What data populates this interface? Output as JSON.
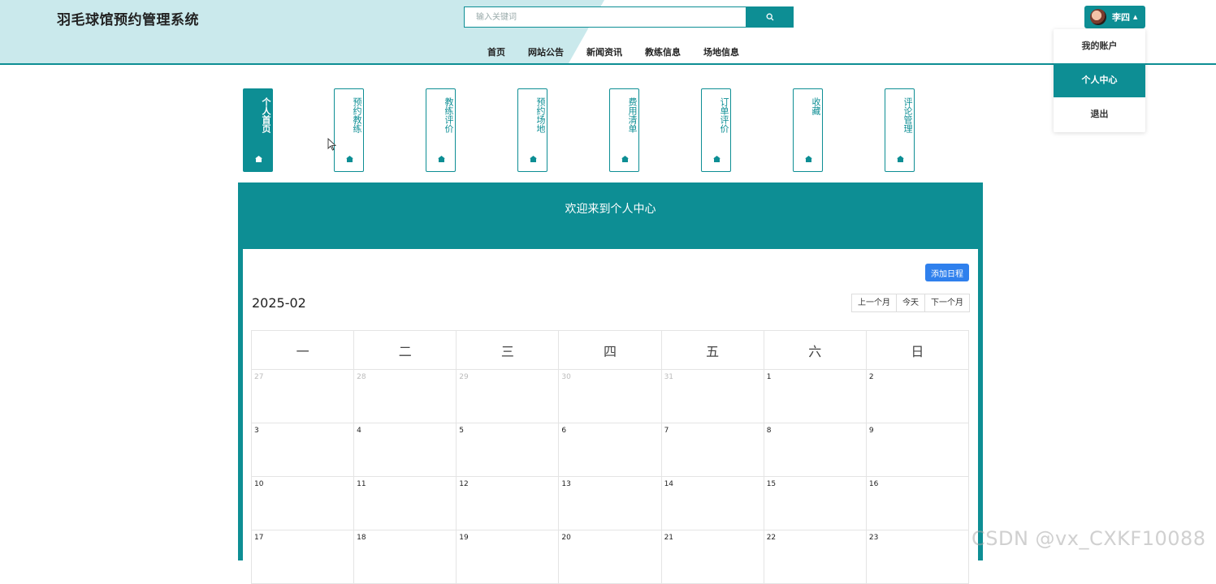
{
  "header": {
    "site_title": "羽毛球馆预约管理系统",
    "search_placeholder": "输入关键词",
    "nav": [
      "首页",
      "网站公告",
      "新闻资讯",
      "教练信息",
      "场地信息"
    ],
    "user_name": "李四",
    "dropdown": [
      {
        "label": "我的账户",
        "active": false
      },
      {
        "label": "个人中心",
        "active": true
      },
      {
        "label": "退出",
        "active": false
      }
    ]
  },
  "tabs": [
    {
      "label": "个人首页",
      "active": true
    },
    {
      "label": "预约教练",
      "active": false
    },
    {
      "label": "教练评价",
      "active": false
    },
    {
      "label": "预约场地",
      "active": false
    },
    {
      "label": "费用清单",
      "active": false
    },
    {
      "label": "订单评价",
      "active": false
    },
    {
      "label": "收藏",
      "active": false
    },
    {
      "label": "评论管理",
      "active": false
    }
  ],
  "main": {
    "welcome": "欢迎来到个人中心",
    "add_schedule": "添加日程"
  },
  "calendar": {
    "month": "2025-02",
    "prev": "上一个月",
    "today": "今天",
    "next": "下一个月",
    "weekdays": [
      "一",
      "二",
      "三",
      "四",
      "五",
      "六",
      "日"
    ],
    "weeks": [
      [
        {
          "d": "27",
          "o": true
        },
        {
          "d": "28",
          "o": true
        },
        {
          "d": "29",
          "o": true
        },
        {
          "d": "30",
          "o": true
        },
        {
          "d": "31",
          "o": true
        },
        {
          "d": "1",
          "o": false
        },
        {
          "d": "2",
          "o": false
        }
      ],
      [
        {
          "d": "3",
          "o": false
        },
        {
          "d": "4",
          "o": false
        },
        {
          "d": "5",
          "o": false
        },
        {
          "d": "6",
          "o": false
        },
        {
          "d": "7",
          "o": false
        },
        {
          "d": "8",
          "o": false
        },
        {
          "d": "9",
          "o": false
        }
      ],
      [
        {
          "d": "10",
          "o": false
        },
        {
          "d": "11",
          "o": false
        },
        {
          "d": "12",
          "o": false
        },
        {
          "d": "13",
          "o": false
        },
        {
          "d": "14",
          "o": false
        },
        {
          "d": "15",
          "o": false
        },
        {
          "d": "16",
          "o": false
        }
      ],
      [
        {
          "d": "17",
          "o": false
        },
        {
          "d": "18",
          "o": false
        },
        {
          "d": "19",
          "o": false
        },
        {
          "d": "20",
          "o": false
        },
        {
          "d": "21",
          "o": false
        },
        {
          "d": "22",
          "o": false
        },
        {
          "d": "23",
          "o": false
        }
      ]
    ]
  },
  "watermark": "CSDN @vx_CXKF10088",
  "colors": {
    "primary": "#0d8e94",
    "header_band": "#cae9ec",
    "add_button": "#2f80ed"
  },
  "icons": {
    "search": "search-icon",
    "tab": "home-icon",
    "cursor": "mouse-pointer-icon"
  }
}
